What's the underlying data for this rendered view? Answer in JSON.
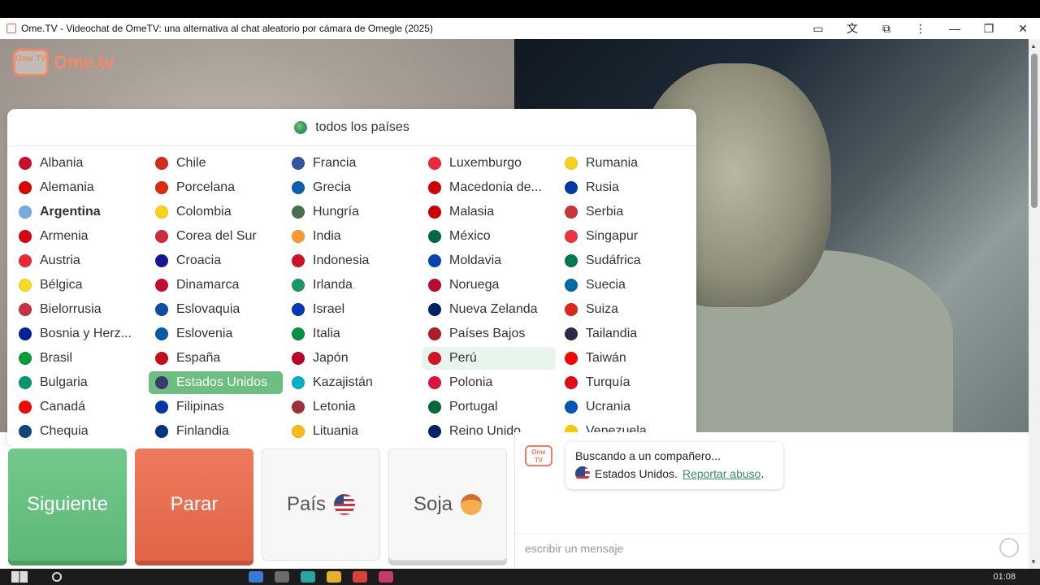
{
  "window": {
    "title": "Ome.TV - Videochat de OmeTV: una alternativa al chat aleatorio por cámara de Omegle (2025)",
    "controls": [
      "minimize",
      "restore",
      "close"
    ]
  },
  "logo": {
    "badge": "Ome TV",
    "text": "Ome.tv"
  },
  "country_panel": {
    "header": "todos los países",
    "countries": [
      {
        "name": "Albania",
        "flag": "#c8102e"
      },
      {
        "name": "Chile",
        "flag": "#d52b1e"
      },
      {
        "name": "Francia",
        "flag": "#3553a4"
      },
      {
        "name": "Luxemburgo",
        "flag": "#ed2939"
      },
      {
        "name": "Rumania",
        "flag": "#fcd116"
      },
      {
        "name": "Alemania",
        "flag": "#dd0000"
      },
      {
        "name": "Porcelana",
        "flag": "#de2910"
      },
      {
        "name": "Grecia",
        "flag": "#0d5eaf"
      },
      {
        "name": "Macedonia de...",
        "flag": "#d20000"
      },
      {
        "name": "Rusia",
        "flag": "#0039a6"
      },
      {
        "name": "Argentina",
        "flag": "#74acdf"
      },
      {
        "name": "Colombia",
        "flag": "#fcd116"
      },
      {
        "name": "Hungría",
        "flag": "#477050"
      },
      {
        "name": "Malasia",
        "flag": "#cc0001"
      },
      {
        "name": "Serbia",
        "flag": "#c6363c"
      },
      {
        "name": "Armenia",
        "flag": "#d90012"
      },
      {
        "name": "Corea del Sur",
        "flag": "#cd2e3a"
      },
      {
        "name": "India",
        "flag": "#ff9933"
      },
      {
        "name": "México",
        "flag": "#006847"
      },
      {
        "name": "Singapur",
        "flag": "#ef3340"
      },
      {
        "name": "Austria",
        "flag": "#ed2939"
      },
      {
        "name": "Croacia",
        "flag": "#171796"
      },
      {
        "name": "Indonesia",
        "flag": "#ce1126"
      },
      {
        "name": "Moldavia",
        "flag": "#0046ae"
      },
      {
        "name": "Sudáfrica",
        "flag": "#007a4d"
      },
      {
        "name": "Bélgica",
        "flag": "#fdda24"
      },
      {
        "name": "Dinamarca",
        "flag": "#c60c30"
      },
      {
        "name": "Irlanda",
        "flag": "#169b62"
      },
      {
        "name": "Noruega",
        "flag": "#ba0c2f"
      },
      {
        "name": "Suecia",
        "flag": "#006aa7"
      },
      {
        "name": "Bielorrusia",
        "flag": "#c8313e"
      },
      {
        "name": "Eslovaquia",
        "flag": "#0b4ea2"
      },
      {
        "name": "Israel",
        "flag": "#0038b8"
      },
      {
        "name": "Nueva Zelanda",
        "flag": "#012169"
      },
      {
        "name": "Suiza",
        "flag": "#da291c"
      },
      {
        "name": "Bosnia y Herz...",
        "flag": "#002395"
      },
      {
        "name": "Eslovenia",
        "flag": "#005da4"
      },
      {
        "name": "Italia",
        "flag": "#009246"
      },
      {
        "name": "Países Bajos",
        "flag": "#ae1c28"
      },
      {
        "name": "Tailandia",
        "flag": "#2d2a4a"
      },
      {
        "name": "Brasil",
        "flag": "#009c3b"
      },
      {
        "name": "España",
        "flag": "#c60b1e"
      },
      {
        "name": "Japón",
        "flag": "#bc002d"
      },
      {
        "name": "Perú",
        "flag": "#d91023"
      },
      {
        "name": "Taiwán",
        "flag": "#fe0000"
      },
      {
        "name": "Bulgaria",
        "flag": "#00966e"
      },
      {
        "name": "Estados Unidos",
        "flag": "#3c3b6e"
      },
      {
        "name": "Kazajistán",
        "flag": "#00afca"
      },
      {
        "name": "Polonia",
        "flag": "#dc143c"
      },
      {
        "name": "Turquía",
        "flag": "#e30a17"
      },
      {
        "name": "Canadá",
        "flag": "#ff0000"
      },
      {
        "name": "Filipinas",
        "flag": "#0038a8"
      },
      {
        "name": "Letonia",
        "flag": "#9e3039"
      },
      {
        "name": "Portugal",
        "flag": "#046a38"
      },
      {
        "name": "Ucrania",
        "flag": "#0057b7"
      },
      {
        "name": "Chequia",
        "flag": "#11457e"
      },
      {
        "name": "Finlandia",
        "flag": "#003580"
      },
      {
        "name": "Lituania",
        "flag": "#fdb913"
      },
      {
        "name": "Reino Unido",
        "flag": "#012169"
      },
      {
        "name": "Venezuela",
        "flag": "#ffcc00"
      }
    ],
    "selected": "Estados Unidos",
    "hovered": "Perú",
    "current_country_bold": "Argentina"
  },
  "buttons": {
    "next": "Siguiente",
    "stop": "Parar",
    "country": "País",
    "gender": "Soja"
  },
  "chat": {
    "status": "Buscando a un compañero...",
    "country": "Estados Unidos.",
    "report": "Reportar abuso",
    "period": ".",
    "placeholder": "escribir un mensaje"
  },
  "taskbar": {
    "time": "01:08"
  }
}
